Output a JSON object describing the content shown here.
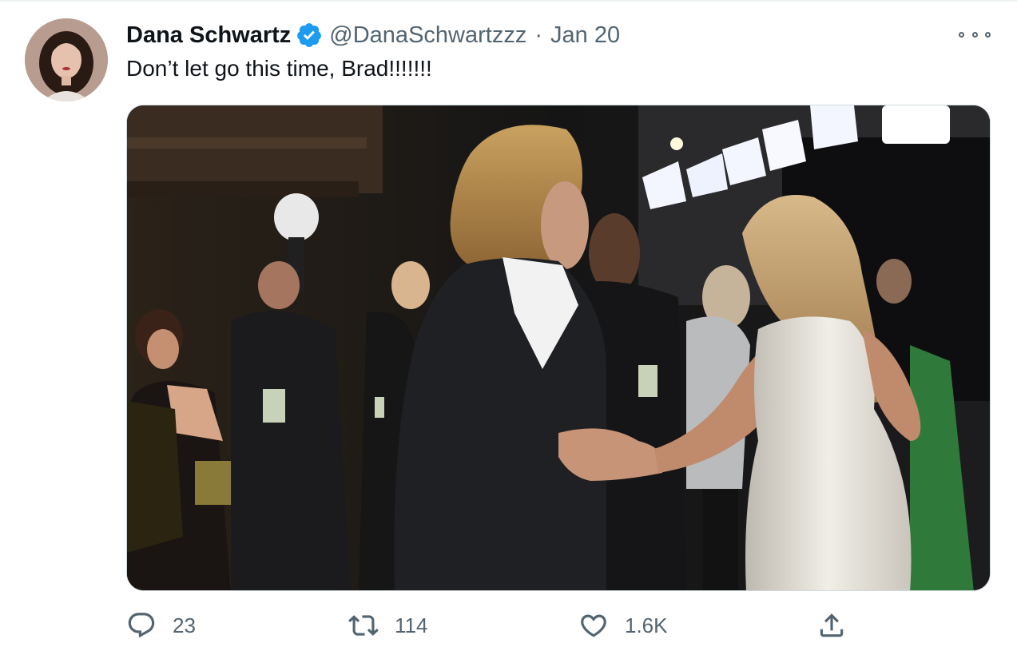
{
  "tweet": {
    "author": {
      "display_name": "Dana Schwartz",
      "handle": "@DanaSchwartzzz",
      "verified": true,
      "avatar_icon": "profile-photo"
    },
    "separator": "·",
    "date": "Jan 20",
    "text": "Don’t let go this time, Brad!!!!!!!",
    "media": {
      "type": "photo"
    },
    "actions": {
      "replies": "23",
      "retweets": "114",
      "likes": "1.6K"
    },
    "icons": {
      "more": "more-options-icon",
      "reply": "reply-icon",
      "retweet": "retweet-icon",
      "like": "heart-icon",
      "share": "share-icon",
      "verified": "verified-badge-icon"
    }
  },
  "colors": {
    "text_primary": "#0f1419",
    "text_secondary": "#536471",
    "verified_blue": "#1d9bf0",
    "border": "#cfd9de"
  }
}
